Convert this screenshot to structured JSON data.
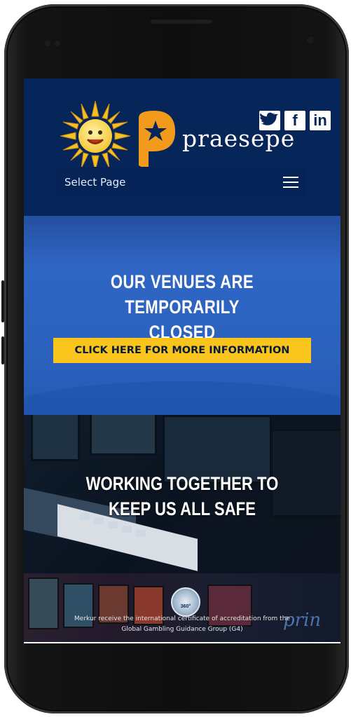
{
  "header": {
    "brand_text": "praesepe",
    "select_page_label": "Select Page",
    "social": [
      {
        "icon": "twitter-icon",
        "glyph": "🐦"
      },
      {
        "icon": "facebook-icon",
        "glyph": "f"
      },
      {
        "icon": "linkedin-icon",
        "glyph": "in"
      }
    ]
  },
  "banner": {
    "title_line1": "OUR VENUES ARE TEMPORARILY",
    "title_line2": "CLOSED",
    "cta_label": "CLICK HERE FOR MORE INFORMATION"
  },
  "slots_section": {
    "title_line1": "WORKING TOGETHER TO",
    "title_line2": "KEEP US ALL SAFE"
  },
  "footer_strip": {
    "caption_line1": "Merkur receive the international certificate of accreditation from the",
    "caption_line2": "Global Gambling Guidance Group (G4)",
    "badge_text": "360°",
    "logo_text": "prin"
  },
  "colors": {
    "header_bg": "#062659",
    "banner_bg": "#2f66c4",
    "cta_bg": "#f9c51d",
    "text_white": "#ffffff"
  }
}
